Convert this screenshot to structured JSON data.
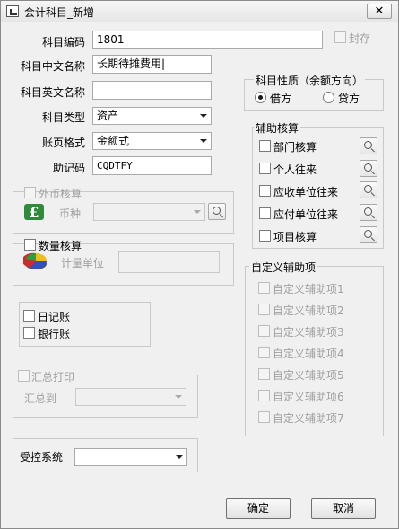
{
  "window": {
    "title": "会计科目_新增",
    "close": "✕"
  },
  "basic": {
    "code_label": "科目编码",
    "code_value": "1801",
    "sealed_label": "封存",
    "cn_name_label": "科目中文名称",
    "cn_name_value": "长期待摊费用|",
    "en_name_label": "科目英文名称",
    "en_name_value": "",
    "type_label": "科目类型",
    "type_value": "资产",
    "format_label": "账页格式",
    "format_value": "金额式",
    "mnemonic_label": "助记码",
    "mnemonic_value": "CQDTFY"
  },
  "foreign": {
    "title": "外币核算",
    "currency_label": "币种",
    "currency_value": ""
  },
  "quantity": {
    "title": "数量核算",
    "unit_label": "计量单位",
    "unit_value": ""
  },
  "books": {
    "journal_label": "日记账",
    "bank_label": "银行账"
  },
  "summary": {
    "title": "汇总打印",
    "to_label": "汇总到",
    "to_value": ""
  },
  "control": {
    "label": "受控系统",
    "value": ""
  },
  "nature": {
    "title": "科目性质（余额方向）",
    "debit": "借方",
    "credit": "贷方",
    "selected": "debit"
  },
  "aux": {
    "title": "辅助核算",
    "items": [
      "部门核算",
      "个人往来",
      "应收单位往来",
      "应付单位往来",
      "项目核算"
    ]
  },
  "custom": {
    "title": "自定义辅助项",
    "items": [
      "自定义辅助项1",
      "自定义辅助项2",
      "自定义辅助项3",
      "自定义辅助项4",
      "自定义辅助项5",
      "自定义辅助项6",
      "自定义辅助项7"
    ]
  },
  "buttons": {
    "ok": "确定",
    "cancel": "取消"
  }
}
